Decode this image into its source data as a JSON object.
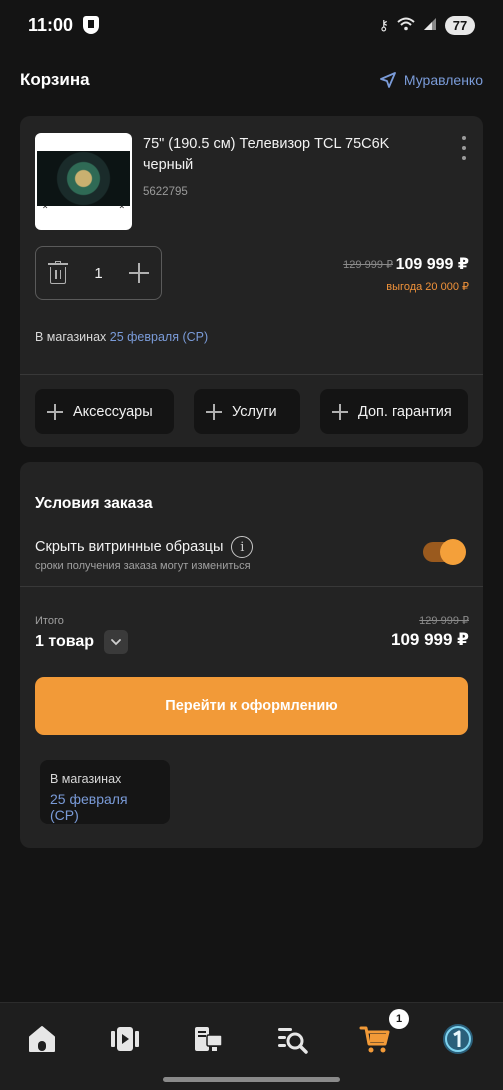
{
  "status_bar": {
    "time": "11:00",
    "battery": "77"
  },
  "header": {
    "title": "Корзина",
    "location": "Муравленко"
  },
  "product": {
    "title": "75\" (190.5 см) Телевизор TCL 75C6K черный",
    "sku": "5622795",
    "quantity": "1",
    "price_old": "129 999 ₽",
    "price_new": "109 999 ₽",
    "savings": "выгода 20 000 ₽",
    "delivery_prefix": "В магазинах",
    "delivery_date": "25 февраля (СР)"
  },
  "addons": [
    {
      "label": "Аксессуары"
    },
    {
      "label": "Услуги"
    },
    {
      "label": "Доп. гарантия"
    }
  ],
  "order": {
    "title": "Условия заказа",
    "toggle_label": "Скрыть витринные образцы",
    "toggle_sub": "сроки получения заказа могут измениться",
    "toggle_on": true,
    "total_label": "Итого",
    "total_count": "1 товар",
    "total_old": "129 999 ₽",
    "total_new": "109 999 ₽",
    "checkout_label": "Перейти к оформлению",
    "store_line1": "В магазинах",
    "store_line2": "25 февраля (СР)"
  },
  "nav": {
    "cart_badge": "1"
  },
  "colors": {
    "accent": "#f29a38",
    "link": "#7a9bd8",
    "background": "#141414",
    "card": "#232323"
  }
}
